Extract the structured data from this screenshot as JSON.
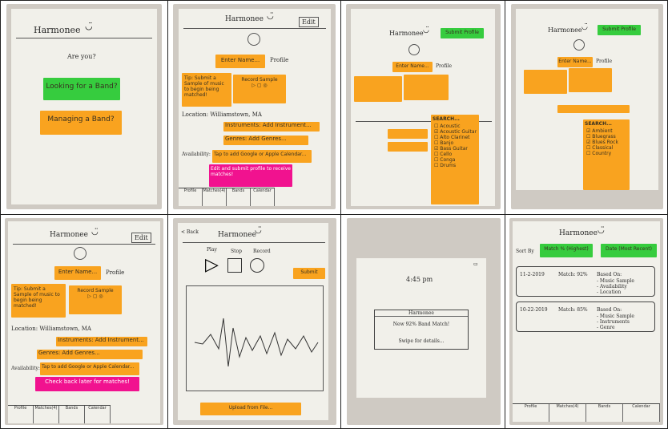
{
  "app": {
    "name": "Harmonee",
    "brand_colors": {
      "orange": "#f9a31f",
      "green": "#36cc3e",
      "pink": "#f1128f",
      "paper": "#f1f0ea"
    }
  },
  "panel1": {
    "title": "Harmonee",
    "question": "Are you?",
    "looking_button": "Looking for a Band?",
    "managing_button": "Managing a Band?"
  },
  "panel2": {
    "title": "Harmonee",
    "edit": "Edit",
    "enter_name": "Enter Name...",
    "profile": "Profile",
    "tip": "Tip: Submit a Sample of music to begin being matched!",
    "record_sample": "Record Sample",
    "location": "Location: Williamstown, MA",
    "instruments": "Instruments: Add Instrument...",
    "genres": "Genres: Add Genres...",
    "availability": "Availability:",
    "availability_value": "Tap to add Google or Apple Calendar...",
    "cta": "Edit and submit profile to receive matches!",
    "tabs": [
      "Profile",
      "Matches(4)",
      "Bands",
      "Calendar"
    ]
  },
  "panel3": {
    "title": "Harmonee",
    "submit": "Submit Profile",
    "enter_name": "Enter Name...",
    "profile": "Profile",
    "search": "SEARCH...",
    "options": [
      "Acoustic",
      "Acoustic Guitar",
      "Alto Clarinet",
      "Banjo",
      "Bass Guitar",
      "Cello",
      "Conga",
      "Drums"
    ]
  },
  "panel4": {
    "title": "Harmonee",
    "submit": "Submit Profile",
    "enter_name": "Enter Name...",
    "profile": "Profile",
    "search": "SEARCH...",
    "options": [
      "Ambient",
      "Bluegrass",
      "Blues Rock",
      "Classical",
      "Country"
    ]
  },
  "panel5": {
    "title": "Harmonee",
    "edit": "Edit",
    "enter_name": "Enter Name...",
    "profile": "Profile",
    "tip": "Tip: Submit a Sample of music to begin being matched!",
    "record_sample": "Record Sample",
    "location": "Location: Williamstown, MA",
    "instruments": "Instruments: Add Instrument...",
    "genres": "Genres: Add Genres...",
    "availability": "Availability:",
    "availability_value": "Tap to add Google or Apple Calendar...",
    "cta": "Check back later for matches!",
    "tabs": [
      "Profile",
      "Matches(4)",
      "Bands",
      "Calendar"
    ]
  },
  "panel6": {
    "back": "< Back",
    "title": "Harmonee",
    "play": "Play",
    "stop": "Stop",
    "record": "Record",
    "submit": "Submit",
    "upload": "Upload from File..."
  },
  "panel7": {
    "time": "4:45 pm",
    "notif_title": "Harmonee",
    "notif_body": "New 92% Band Match!",
    "notif_hint": "Swipe for details..."
  },
  "panel8": {
    "title": "Harmonee",
    "sort_by": "Sort By",
    "match_btn": "Match % (Highest)",
    "date_btn": "Date (Most Recent)",
    "matches": [
      {
        "date": "11-2-2019",
        "match": "Match: 92%",
        "based": "Based On:",
        "reasons": [
          "- Music Sample",
          "- Availability",
          "- Location"
        ]
      },
      {
        "date": "10-22-2019",
        "match": "Match: 85%",
        "based": "Based On:",
        "reasons": [
          "- Music Sample",
          "- Instruments",
          "- Genre"
        ]
      }
    ],
    "tabs": [
      "Profile",
      "Matches(4)",
      "Bands",
      "Calendar"
    ]
  }
}
